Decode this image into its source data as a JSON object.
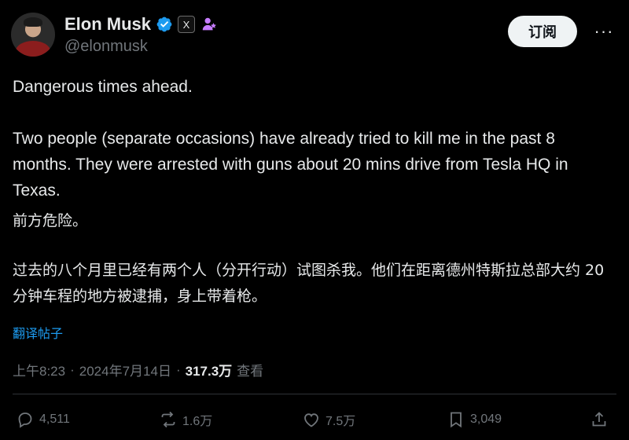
{
  "author": {
    "display_name": "Elon Musk",
    "handle": "@elonmusk",
    "verified_icon": "verified-badge-icon",
    "affiliation_badge": "X",
    "affiliation_icon": "affiliated-account-icon"
  },
  "header": {
    "subscribe_label": "订阅",
    "more_label": "···"
  },
  "tweet": {
    "line_en_1": "Dangerous times ahead.",
    "line_en_2": "Two people (separate occasions) have already tried to kill me in the past 8 months. They were arrested with guns about 20 mins drive from Tesla HQ in Texas.",
    "line_zh_1": "前方危险。",
    "line_zh_2": "过去的八个月里已经有两个人（分开行动）试图杀我。他们在距离德州特斯拉总部大约 20 分钟车程的地方被逮捕，身上带着枪。",
    "translate_label": "翻译帖子"
  },
  "meta": {
    "time": "上午8:23",
    "sep1": "·",
    "date": "2024年7月14日",
    "sep2": "·",
    "views_count": "317.3万",
    "views_label": "查看"
  },
  "actions": {
    "replies": "4,511",
    "reposts": "1.6万",
    "likes": "7.5万",
    "bookmarks": "3,049"
  },
  "colors": {
    "background": "#000000",
    "text": "#e7e9ea",
    "muted": "#71767b",
    "link": "#1d9bf0",
    "verified": "#1d9bf0",
    "affiliation": "#c77dff"
  }
}
